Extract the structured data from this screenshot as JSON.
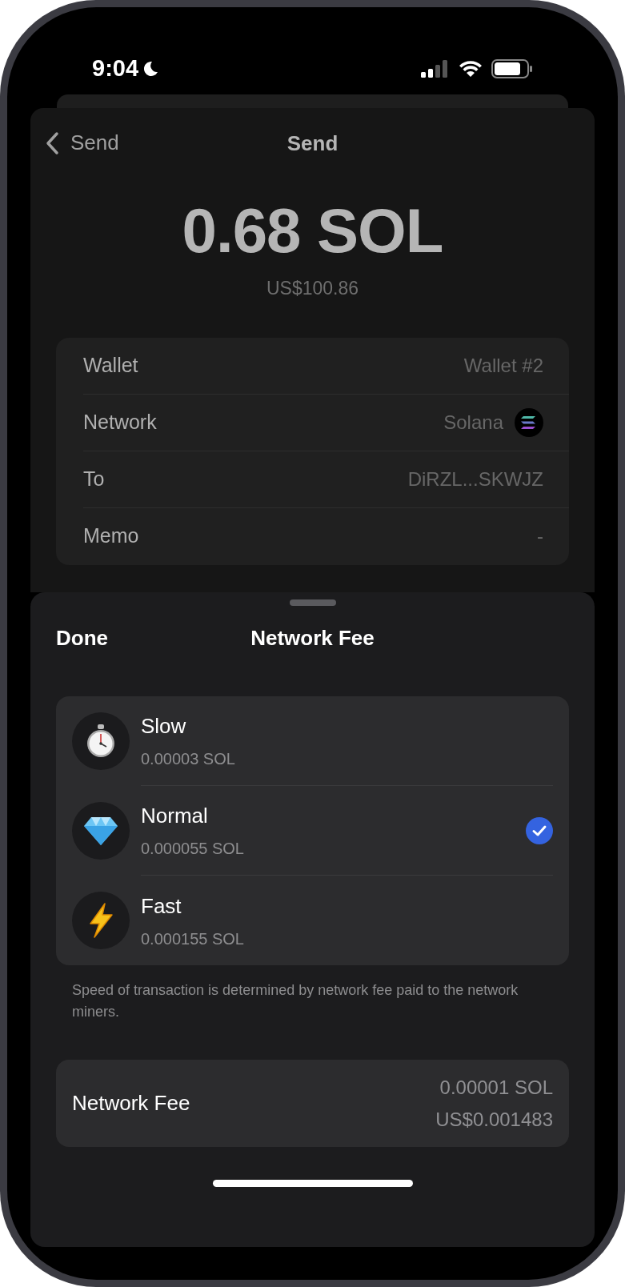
{
  "status_bar": {
    "time": "9:04"
  },
  "header": {
    "back_label": "Send",
    "title": "Send"
  },
  "amount": {
    "value": "0.68 SOL",
    "fiat": "US$100.86"
  },
  "details": [
    {
      "kind": "text",
      "label": "Wallet",
      "value": "Wallet #2"
    },
    {
      "kind": "network",
      "label": "Network",
      "value": "Solana"
    },
    {
      "kind": "text",
      "label": "To",
      "value": "DiRZL...SKWJZ"
    },
    {
      "kind": "text",
      "label": "Memo",
      "value": "-"
    }
  ],
  "sheet": {
    "done": "Done",
    "title": "Network Fee"
  },
  "fee_options": [
    {
      "kind": "stopwatch",
      "name": "Slow",
      "amount": "0.00003 SOL",
      "selected": false
    },
    {
      "kind": "diamond",
      "name": "Normal",
      "amount": "0.000055 SOL",
      "selected": true
    },
    {
      "kind": "lightning",
      "name": "Fast",
      "amount": "0.000155 SOL",
      "selected": false
    }
  ],
  "note": "Speed of transaction is determined by network fee paid to the network miners.",
  "summary": {
    "label": "Network Fee",
    "amount": "0.00001 SOL",
    "fiat": "US$0.001483"
  }
}
